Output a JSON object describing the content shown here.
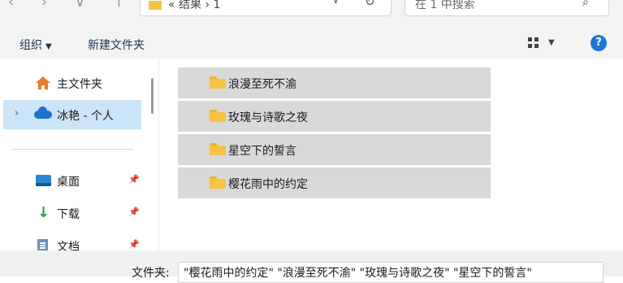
{
  "address_bar": {
    "crumb": "« 结果 › 1",
    "search_placeholder": "在 1 中搜索"
  },
  "toolbar": {
    "organize_label": "组织",
    "new_folder_label": "新建文件夹"
  },
  "nav_pane": {
    "items": [
      {
        "label": "主文件夹",
        "icon": "home-icon"
      },
      {
        "label": "冰艳 - 个人",
        "icon": "onedrive-cloud-icon",
        "selected": true
      },
      {
        "label": "桌面",
        "icon": "desktop-icon",
        "pinned": true
      },
      {
        "label": "下载",
        "icon": "download-icon",
        "pinned": true
      },
      {
        "label": "文档",
        "icon": "documents-icon",
        "pinned": true
      }
    ]
  },
  "files": [
    {
      "name": "浪漫至死不渝",
      "selected": true
    },
    {
      "name": "玫瑰与诗歌之夜",
      "selected": true
    },
    {
      "name": "星空下的誓言",
      "selected": true
    },
    {
      "name": "樱花雨中的约定",
      "selected": true
    }
  ],
  "file_name_bar": {
    "label": "文件夹:",
    "value": "\"樱花雨中的约定\" \"浪漫至死不渝\" \"玫瑰与诗歌之夜\" \"星空下的誓言\""
  },
  "colors": {
    "selection_gray": "#d9d9d9",
    "nav_selected": "#cce4f7",
    "help_blue": "#1e77d2",
    "folder_yellow": "#f6c444"
  }
}
